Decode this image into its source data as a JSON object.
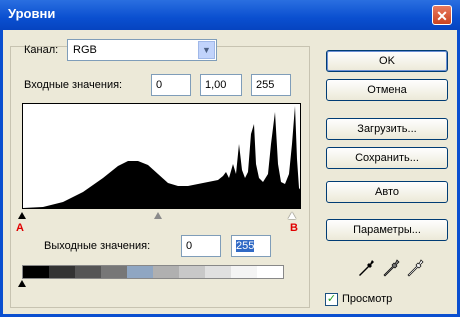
{
  "window": {
    "title": "Уровни",
    "close_label": "✕"
  },
  "channel": {
    "label": "Канал:",
    "value": "RGB"
  },
  "input_levels": {
    "label": "Входные значения:",
    "black": "0",
    "gamma": "1,00",
    "white": "255"
  },
  "output_levels": {
    "label": "Выходные значения:",
    "black": "0",
    "white": "255"
  },
  "markers": {
    "a": "A",
    "b": "B"
  },
  "buttons": {
    "ok": "OK",
    "cancel": "Отмена",
    "load": "Загрузить...",
    "save": "Сохранить...",
    "auto": "Авто",
    "options": "Параметры..."
  },
  "preview": {
    "label": "Просмотр",
    "checked": "✓"
  },
  "icons": {
    "close": "close-icon",
    "dropdown": "chevron-down-icon",
    "eyedroppers": [
      "black-eyedropper-icon",
      "gray-eyedropper-icon",
      "white-eyedropper-icon"
    ]
  },
  "colors": {
    "titlebar": "#0a4fd0",
    "marker": "#e00000",
    "selection": "#316ac5"
  }
}
